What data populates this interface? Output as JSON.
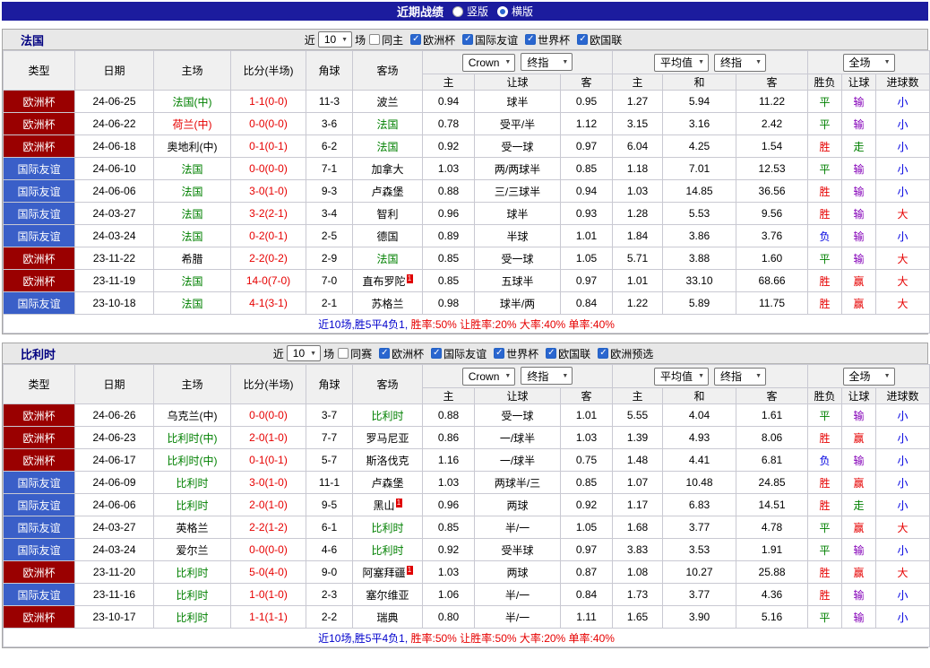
{
  "title_bar": {
    "title": "近期战绩",
    "view_options": [
      {
        "label": "竖版",
        "selected": false
      },
      {
        "label": "横版",
        "selected": true
      }
    ]
  },
  "colors": {
    "title_bar_bg": "#1c1c9e",
    "cup_bg": "#9a0000",
    "friendly_bg": "#3a5fc8",
    "win_red": "#e60000",
    "team_green": "#008000",
    "lose_blue": "#0000e0",
    "handicap_lose_purple": "#8400b8",
    "score_red": "#e60000",
    "summary_lead_blue": "#0000cc",
    "summary_stats_red": "#e60000",
    "checkbox_blue": "#2a66cf"
  },
  "table_header": {
    "main_cols": [
      "类型",
      "日期",
      "主场",
      "比分(半场)",
      "角球",
      "客场"
    ],
    "odds_dropdowns": [
      "Crown",
      "终指"
    ],
    "avg_dropdowns": [
      "平均值",
      "终指"
    ],
    "result_dropdown": "全场",
    "sub_cols": [
      "主",
      "让球",
      "客",
      "主",
      "和",
      "客",
      "胜负",
      "让球",
      "进球数"
    ]
  },
  "sections": [
    {
      "team": "法国",
      "filter": {
        "near": "近",
        "count": "10",
        "unit": "场",
        "toggle": {
          "label": "同主",
          "checked": false
        },
        "competitions": [
          {
            "label": "欧洲杯",
            "checked": true
          },
          {
            "label": "国际友谊",
            "checked": true
          },
          {
            "label": "世界杯",
            "checked": true
          },
          {
            "label": "欧国联",
            "checked": true
          }
        ]
      },
      "rows": [
        {
          "type": "欧洲杯",
          "style": "cup",
          "date": "24-06-25",
          "home": {
            "text": "法国(中)",
            "color": "green"
          },
          "score": "1-1(0-0)",
          "corner": "11-3",
          "away": {
            "text": "波兰",
            "color": "black"
          },
          "odds": [
            "0.94",
            "球半",
            "0.95"
          ],
          "avg": [
            "1.27",
            "5.94",
            "11.22"
          ],
          "res": [
            [
              "平",
              "green"
            ],
            [
              "输",
              "purple"
            ],
            [
              "小",
              "blue"
            ]
          ]
        },
        {
          "type": "欧洲杯",
          "style": "cup",
          "date": "24-06-22",
          "home": {
            "text": "荷兰(中)",
            "color": "red"
          },
          "score": "0-0(0-0)",
          "corner": "3-6",
          "away": {
            "text": "法国",
            "color": "green"
          },
          "odds": [
            "0.78",
            "受平/半",
            "1.12"
          ],
          "avg": [
            "3.15",
            "3.16",
            "2.42"
          ],
          "res": [
            [
              "平",
              "green"
            ],
            [
              "输",
              "purple"
            ],
            [
              "小",
              "blue"
            ]
          ]
        },
        {
          "type": "欧洲杯",
          "style": "cup",
          "date": "24-06-18",
          "home": {
            "text": "奥地利(中)",
            "color": "black"
          },
          "score": "0-1(0-1)",
          "corner": "6-2",
          "away": {
            "text": "法国",
            "color": "green"
          },
          "odds": [
            "0.92",
            "受一球",
            "0.97"
          ],
          "avg": [
            "6.04",
            "4.25",
            "1.54"
          ],
          "res": [
            [
              "胜",
              "red"
            ],
            [
              "走",
              "green"
            ],
            [
              "小",
              "blue"
            ]
          ]
        },
        {
          "type": "国际友谊",
          "style": "friendly",
          "date": "24-06-10",
          "home": {
            "text": "法国",
            "color": "green"
          },
          "score": "0-0(0-0)",
          "corner": "7-1",
          "away": {
            "text": "加拿大",
            "color": "black"
          },
          "odds": [
            "1.03",
            "两/两球半",
            "0.85"
          ],
          "avg": [
            "1.18",
            "7.01",
            "12.53"
          ],
          "res": [
            [
              "平",
              "green"
            ],
            [
              "输",
              "purple"
            ],
            [
              "小",
              "blue"
            ]
          ]
        },
        {
          "type": "国际友谊",
          "style": "friendly",
          "date": "24-06-06",
          "home": {
            "text": "法国",
            "color": "green"
          },
          "score": "3-0(1-0)",
          "corner": "9-3",
          "away": {
            "text": "卢森堡",
            "color": "black"
          },
          "odds": [
            "0.88",
            "三/三球半",
            "0.94"
          ],
          "avg": [
            "1.03",
            "14.85",
            "36.56"
          ],
          "res": [
            [
              "胜",
              "red"
            ],
            [
              "输",
              "purple"
            ],
            [
              "小",
              "blue"
            ]
          ]
        },
        {
          "type": "国际友谊",
          "style": "friendly",
          "date": "24-03-27",
          "home": {
            "text": "法国",
            "color": "green"
          },
          "score": "3-2(2-1)",
          "corner": "3-4",
          "away": {
            "text": "智利",
            "color": "black"
          },
          "odds": [
            "0.96",
            "球半",
            "0.93"
          ],
          "avg": [
            "1.28",
            "5.53",
            "9.56"
          ],
          "res": [
            [
              "胜",
              "red"
            ],
            [
              "输",
              "purple"
            ],
            [
              "大",
              "red"
            ]
          ]
        },
        {
          "type": "国际友谊",
          "style": "friendly",
          "date": "24-03-24",
          "home": {
            "text": "法国",
            "color": "green"
          },
          "score": "0-2(0-1)",
          "corner": "2-5",
          "away": {
            "text": "德国",
            "color": "black"
          },
          "odds": [
            "0.89",
            "半球",
            "1.01"
          ],
          "avg": [
            "1.84",
            "3.86",
            "3.76"
          ],
          "res": [
            [
              "负",
              "blue"
            ],
            [
              "输",
              "purple"
            ],
            [
              "小",
              "blue"
            ]
          ]
        },
        {
          "type": "欧洲杯",
          "style": "cup",
          "date": "23-11-22",
          "home": {
            "text": "希腊",
            "color": "black"
          },
          "score": "2-2(0-2)",
          "corner": "2-9",
          "away": {
            "text": "法国",
            "color": "green"
          },
          "odds": [
            "0.85",
            "受一球",
            "1.05"
          ],
          "avg": [
            "5.71",
            "3.88",
            "1.60"
          ],
          "res": [
            [
              "平",
              "green"
            ],
            [
              "输",
              "purple"
            ],
            [
              "大",
              "red"
            ]
          ]
        },
        {
          "type": "欧洲杯",
          "style": "cup",
          "date": "23-11-19",
          "home": {
            "text": "法国",
            "color": "green"
          },
          "score": "14-0(7-0)",
          "corner": "7-0",
          "away": {
            "text": "直布罗陀",
            "color": "black",
            "redcard": "1"
          },
          "odds": [
            "0.85",
            "五球半",
            "0.97"
          ],
          "avg": [
            "1.01",
            "33.10",
            "68.66"
          ],
          "res": [
            [
              "胜",
              "red"
            ],
            [
              "赢",
              "red"
            ],
            [
              "大",
              "red"
            ]
          ]
        },
        {
          "type": "国际友谊",
          "style": "friendly",
          "date": "23-10-18",
          "home": {
            "text": "法国",
            "color": "green"
          },
          "score": "4-1(3-1)",
          "corner": "2-1",
          "away": {
            "text": "苏格兰",
            "color": "black"
          },
          "odds": [
            "0.98",
            "球半/两",
            "0.84"
          ],
          "avg": [
            "1.22",
            "5.89",
            "11.75"
          ],
          "res": [
            [
              "胜",
              "red"
            ],
            [
              "赢",
              "red"
            ],
            [
              "大",
              "red"
            ]
          ]
        }
      ],
      "summary": {
        "lead": "近10场,胜5平4负1,",
        "stats": [
          "胜率:50%",
          "让胜率:20%",
          "大率:40%",
          "单率:40%"
        ]
      }
    },
    {
      "team": "比利时",
      "filter": {
        "near": "近",
        "count": "10",
        "unit": "场",
        "toggle": {
          "label": "同赛",
          "checked": false
        },
        "competitions": [
          {
            "label": "欧洲杯",
            "checked": true
          },
          {
            "label": "国际友谊",
            "checked": true
          },
          {
            "label": "世界杯",
            "checked": true
          },
          {
            "label": "欧国联",
            "checked": true
          },
          {
            "label": "欧洲预选",
            "checked": true
          }
        ]
      },
      "rows": [
        {
          "type": "欧洲杯",
          "style": "cup",
          "date": "24-06-26",
          "home": {
            "text": "乌克兰(中)",
            "color": "black"
          },
          "score": "0-0(0-0)",
          "corner": "3-7",
          "away": {
            "text": "比利时",
            "color": "green"
          },
          "odds": [
            "0.88",
            "受一球",
            "1.01"
          ],
          "avg": [
            "5.55",
            "4.04",
            "1.61"
          ],
          "res": [
            [
              "平",
              "green"
            ],
            [
              "输",
              "purple"
            ],
            [
              "小",
              "blue"
            ]
          ]
        },
        {
          "type": "欧洲杯",
          "style": "cup",
          "date": "24-06-23",
          "home": {
            "text": "比利时(中)",
            "color": "green"
          },
          "score": "2-0(1-0)",
          "corner": "7-7",
          "away": {
            "text": "罗马尼亚",
            "color": "black"
          },
          "odds": [
            "0.86",
            "一/球半",
            "1.03"
          ],
          "avg": [
            "1.39",
            "4.93",
            "8.06"
          ],
          "res": [
            [
              "胜",
              "red"
            ],
            [
              "赢",
              "red"
            ],
            [
              "小",
              "blue"
            ]
          ]
        },
        {
          "type": "欧洲杯",
          "style": "cup",
          "date": "24-06-17",
          "home": {
            "text": "比利时(中)",
            "color": "green"
          },
          "score": "0-1(0-1)",
          "corner": "5-7",
          "away": {
            "text": "斯洛伐克",
            "color": "black"
          },
          "odds": [
            "1.16",
            "一/球半",
            "0.75"
          ],
          "avg": [
            "1.48",
            "4.41",
            "6.81"
          ],
          "res": [
            [
              "负",
              "blue"
            ],
            [
              "输",
              "purple"
            ],
            [
              "小",
              "blue"
            ]
          ]
        },
        {
          "type": "国际友谊",
          "style": "friendly",
          "date": "24-06-09",
          "home": {
            "text": "比利时",
            "color": "green"
          },
          "score": "3-0(1-0)",
          "corner": "11-1",
          "away": {
            "text": "卢森堡",
            "color": "black"
          },
          "odds": [
            "1.03",
            "两球半/三",
            "0.85"
          ],
          "avg": [
            "1.07",
            "10.48",
            "24.85"
          ],
          "res": [
            [
              "胜",
              "red"
            ],
            [
              "赢",
              "red"
            ],
            [
              "小",
              "blue"
            ]
          ]
        },
        {
          "type": "国际友谊",
          "style": "friendly",
          "date": "24-06-06",
          "home": {
            "text": "比利时",
            "color": "green"
          },
          "score": "2-0(1-0)",
          "corner": "9-5",
          "away": {
            "text": "黑山",
            "color": "black",
            "redcard": "1"
          },
          "odds": [
            "0.96",
            "两球",
            "0.92"
          ],
          "avg": [
            "1.17",
            "6.83",
            "14.51"
          ],
          "res": [
            [
              "胜",
              "red"
            ],
            [
              "走",
              "green"
            ],
            [
              "小",
              "blue"
            ]
          ]
        },
        {
          "type": "国际友谊",
          "style": "friendly",
          "date": "24-03-27",
          "home": {
            "text": "英格兰",
            "color": "black"
          },
          "score": "2-2(1-2)",
          "corner": "6-1",
          "away": {
            "text": "比利时",
            "color": "green"
          },
          "odds": [
            "0.85",
            "半/一",
            "1.05"
          ],
          "avg": [
            "1.68",
            "3.77",
            "4.78"
          ],
          "res": [
            [
              "平",
              "green"
            ],
            [
              "赢",
              "red"
            ],
            [
              "大",
              "red"
            ]
          ]
        },
        {
          "type": "国际友谊",
          "style": "friendly",
          "date": "24-03-24",
          "home": {
            "text": "爱尔兰",
            "color": "black"
          },
          "score": "0-0(0-0)",
          "corner": "4-6",
          "away": {
            "text": "比利时",
            "color": "green"
          },
          "odds": [
            "0.92",
            "受半球",
            "0.97"
          ],
          "avg": [
            "3.83",
            "3.53",
            "1.91"
          ],
          "res": [
            [
              "平",
              "green"
            ],
            [
              "输",
              "purple"
            ],
            [
              "小",
              "blue"
            ]
          ]
        },
        {
          "type": "欧洲杯",
          "style": "cup",
          "date": "23-11-20",
          "home": {
            "text": "比利时",
            "color": "green"
          },
          "score": "5-0(4-0)",
          "corner": "9-0",
          "away": {
            "text": "阿塞拜疆",
            "color": "black",
            "redcard": "1"
          },
          "odds": [
            "1.03",
            "两球",
            "0.87"
          ],
          "avg": [
            "1.08",
            "10.27",
            "25.88"
          ],
          "res": [
            [
              "胜",
              "red"
            ],
            [
              "赢",
              "red"
            ],
            [
              "大",
              "red"
            ]
          ]
        },
        {
          "type": "国际友谊",
          "style": "friendly",
          "date": "23-11-16",
          "home": {
            "text": "比利时",
            "color": "green"
          },
          "score": "1-0(1-0)",
          "corner": "2-3",
          "away": {
            "text": "塞尔维亚",
            "color": "black"
          },
          "odds": [
            "1.06",
            "半/一",
            "0.84"
          ],
          "avg": [
            "1.73",
            "3.77",
            "4.36"
          ],
          "res": [
            [
              "胜",
              "red"
            ],
            [
              "输",
              "purple"
            ],
            [
              "小",
              "blue"
            ]
          ]
        },
        {
          "type": "欧洲杯",
          "style": "cup",
          "date": "23-10-17",
          "home": {
            "text": "比利时",
            "color": "green"
          },
          "score": "1-1(1-1)",
          "corner": "2-2",
          "away": {
            "text": "瑞典",
            "color": "black"
          },
          "odds": [
            "0.80",
            "半/一",
            "1.11"
          ],
          "avg": [
            "1.65",
            "3.90",
            "5.16"
          ],
          "res": [
            [
              "平",
              "green"
            ],
            [
              "输",
              "purple"
            ],
            [
              "小",
              "blue"
            ]
          ]
        }
      ],
      "summary": {
        "lead": "近10场,胜5平4负1,",
        "stats": [
          "胜率:50%",
          "让胜率:50%",
          "大率:20%",
          "单率:40%"
        ]
      }
    }
  ]
}
